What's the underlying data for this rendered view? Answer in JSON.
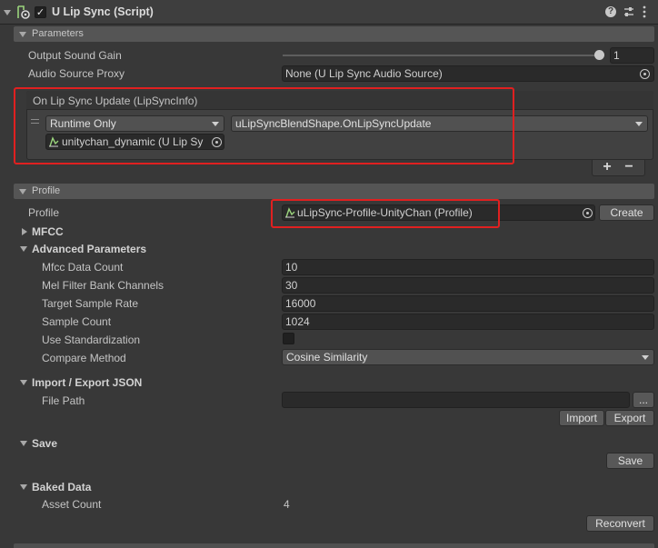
{
  "component": {
    "title": "U Lip Sync (Script)",
    "enabled": true,
    "help_icon": "question-circle-icon",
    "settings_icon": "sliders-icon",
    "menu_icon": "vertical-dots-icon"
  },
  "parameters": {
    "section": "Parameters",
    "output_sound_gain": {
      "label": "Output Sound Gain",
      "value": "1",
      "slider_fraction": 1.0
    },
    "audio_source_proxy": {
      "label": "Audio Source Proxy",
      "value": "None (U Lip Sync Audio Source)"
    }
  },
  "event": {
    "header": "On Lip Sync Update (LipSyncInfo)",
    "runtime": "Runtime Only",
    "function": "uLipSyncBlendShape.OnLipSyncUpdate",
    "object": "unitychan_dynamic (U Lip Sy",
    "add_label": "+",
    "remove_label": "−"
  },
  "profile": {
    "section": "Profile",
    "label": "Profile",
    "value": "uLipSync-Profile-UnityChan (Profile)",
    "create_label": "Create",
    "mfcc": "MFCC",
    "advanced": "Advanced Parameters",
    "rows": [
      {
        "label": "Mfcc Data Count",
        "value": "10"
      },
      {
        "label": "Mel Filter Bank Channels",
        "value": "30"
      },
      {
        "label": "Target Sample Rate",
        "value": "16000"
      },
      {
        "label": "Sample Count",
        "value": "1024"
      }
    ],
    "use_standardization": {
      "label": "Use Standardization",
      "checked": false
    },
    "compare_method": {
      "label": "Compare Method",
      "value": "Cosine Similarity"
    }
  },
  "import_export": {
    "header": "Import / Export JSON",
    "file_path_label": "File Path",
    "file_path_value": "",
    "browse_label": "...",
    "import_label": "Import",
    "export_label": "Export"
  },
  "save": {
    "header": "Save",
    "button": "Save"
  },
  "baked": {
    "header": "Baked Data",
    "asset_count_label": "Asset Count",
    "asset_count_value": "4",
    "reconvert_label": "Reconvert"
  },
  "colors": {
    "highlight": "#e02020",
    "background": "#383838",
    "field": "#2a2a2a"
  }
}
